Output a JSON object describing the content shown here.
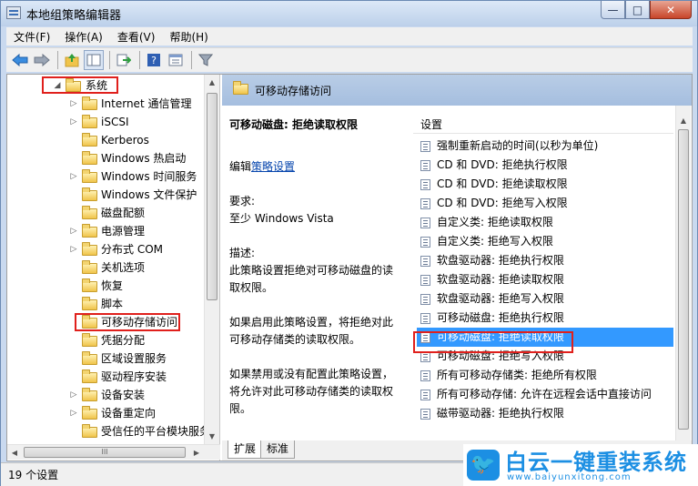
{
  "window": {
    "title": "本地组策略编辑器",
    "minimize": "—",
    "maximize": "□",
    "close": "✕"
  },
  "menu": [
    "文件(F)",
    "操作(A)",
    "查看(V)",
    "帮助(H)"
  ],
  "toolbar": {
    "icons": [
      "back-icon",
      "forward-icon",
      "up-folder-icon",
      "show-hide-tree-icon",
      "export-icon",
      "help-icon",
      "properties-icon",
      "filter-icon"
    ]
  },
  "tree": {
    "items": [
      {
        "label": "系统",
        "expanded": true
      },
      {
        "label": "Internet 通信管理",
        "expandable": true
      },
      {
        "label": "iSCSI",
        "expandable": true
      },
      {
        "label": "Kerberos",
        "expandable": false
      },
      {
        "label": "Windows 热启动",
        "expandable": false
      },
      {
        "label": "Windows 时间服务",
        "expandable": true
      },
      {
        "label": "Windows 文件保护",
        "expandable": false
      },
      {
        "label": "磁盘配额",
        "expandable": false
      },
      {
        "label": "电源管理",
        "expandable": true
      },
      {
        "label": "分布式 COM",
        "expandable": true
      },
      {
        "label": "关机选项",
        "expandable": false
      },
      {
        "label": "恢复",
        "expandable": false
      },
      {
        "label": "脚本",
        "expandable": false
      },
      {
        "label": "可移动存储访问",
        "expandable": false
      },
      {
        "label": "凭据分配",
        "expandable": false
      },
      {
        "label": "区域设置服务",
        "expandable": false
      },
      {
        "label": "驱动程序安装",
        "expandable": false
      },
      {
        "label": "设备安装",
        "expandable": true
      },
      {
        "label": "设备重定向",
        "expandable": true
      },
      {
        "label": "受信任的平台模块服务",
        "expandable": false
      }
    ]
  },
  "header": {
    "title": "可移动存储访问"
  },
  "description": {
    "heading": "可移动磁盘: 拒绝读取权限",
    "edit_prefix": "编辑",
    "edit_link": "策略设置",
    "requirement_label": "要求:",
    "requirement_value": "至少 Windows Vista",
    "desc_label": "描述:",
    "desc_text": "此策略设置拒绝对可移动磁盘的读取权限。",
    "enabled_text": "如果启用此策略设置，将拒绝对此可移动存储类的读取权限。",
    "disabled_text": "如果禁用或没有配置此策略设置，将允许对此可移动存储类的读取权限。"
  },
  "settings": {
    "column_header": "设置",
    "rows": [
      "强制重新启动的时间(以秒为单位)",
      "CD 和 DVD: 拒绝执行权限",
      "CD 和 DVD: 拒绝读取权限",
      "CD 和 DVD: 拒绝写入权限",
      "自定义类: 拒绝读取权限",
      "自定义类: 拒绝写入权限",
      "软盘驱动器: 拒绝执行权限",
      "软盘驱动器: 拒绝读取权限",
      "软盘驱动器: 拒绝写入权限",
      "可移动磁盘: 拒绝执行权限",
      "可移动磁盘: 拒绝读取权限",
      "可移动磁盘: 拒绝写入权限",
      "所有可移动存储类: 拒绝所有权限",
      "所有可移动存储: 允许在远程会话中直接访问",
      "磁带驱动器: 拒绝执行权限"
    ],
    "selected_index": 10
  },
  "tabs": [
    "扩展",
    "标准"
  ],
  "status": {
    "text": "19 个设置"
  },
  "watermark": {
    "title": "白云一键重装系统",
    "url": "www.baiyunxitong.com"
  },
  "colors": {
    "selection": "#3399ff",
    "highlight_box": "#e0201c",
    "header_bg": "#b9cde6",
    "watermark": "#1c8fe3"
  }
}
